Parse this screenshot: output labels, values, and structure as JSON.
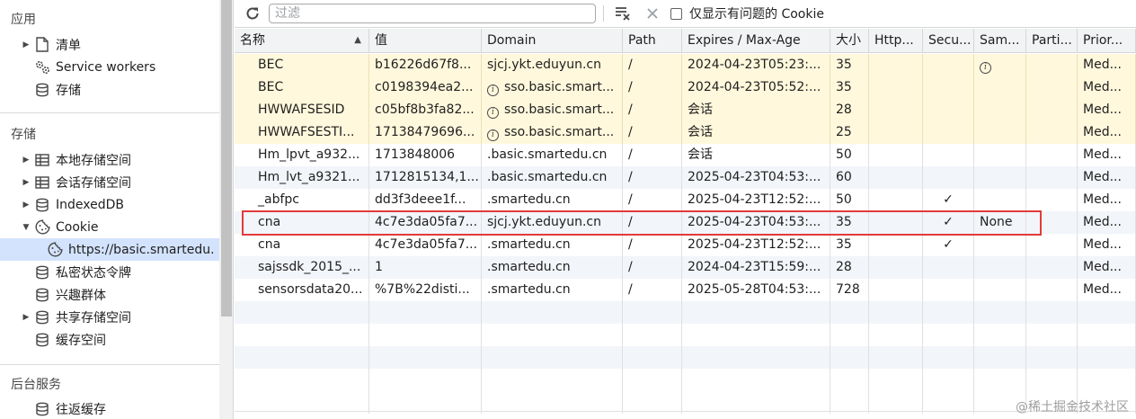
{
  "sidebar": {
    "sections": [
      {
        "title": "应用"
      },
      {
        "title": "存储"
      },
      {
        "title": "后台服务"
      }
    ],
    "app_items": [
      {
        "label": "清单",
        "icon": "document-icon"
      },
      {
        "label": "Service workers",
        "icon": "gears-icon"
      },
      {
        "label": "存储",
        "icon": "database-icon"
      }
    ],
    "storage_items": [
      {
        "label": "本地存储空间",
        "icon": "grid-icon"
      },
      {
        "label": "会话存储空间",
        "icon": "grid-icon"
      },
      {
        "label": "IndexedDB",
        "icon": "database-icon"
      },
      {
        "label": "Cookie",
        "icon": "cookie-icon"
      },
      {
        "label": "https://basic.smartedu.",
        "icon": "cookie-icon"
      },
      {
        "label": "私密状态令牌",
        "icon": "database-icon"
      },
      {
        "label": "兴趣群体",
        "icon": "database-icon"
      },
      {
        "label": "共享存储空间",
        "icon": "database-icon"
      },
      {
        "label": "缓存空间",
        "icon": "database-icon"
      }
    ],
    "bg_items": [
      {
        "label": "往返缓存",
        "icon": "database-icon"
      }
    ]
  },
  "toolbar": {
    "filter_placeholder": "过滤",
    "issues_only_label": "仅显示有问题的 Cookie"
  },
  "table": {
    "headers": [
      "名称",
      "值",
      "Domain",
      "Path",
      "Expires / Max-Age",
      "大小",
      "Http...",
      "Secu...",
      "Sam...",
      "Parti...",
      "Prior..."
    ],
    "rows": [
      {
        "name": "BEC",
        "value": "b16226d67f8...",
        "domain": "sjcj.ykt.eduyun.cn",
        "domain_info": false,
        "path": "/",
        "expires": "2024-04-23T05:23:...",
        "size": "35",
        "http": "",
        "secure": "",
        "samesite": "",
        "samesite_info": true,
        "partition": "",
        "priority": "Med..."
      },
      {
        "name": "BEC",
        "value": "c0198394ea2...",
        "domain": "sso.basic.smart...",
        "domain_info": true,
        "path": "/",
        "expires": "2024-04-23T05:52:...",
        "size": "35",
        "http": "",
        "secure": "",
        "samesite": "",
        "samesite_info": false,
        "partition": "",
        "priority": "Med..."
      },
      {
        "name": "HWWAFSESID",
        "value": "c05bf8b3fa82...",
        "domain": "sso.basic.smart...",
        "domain_info": true,
        "path": "/",
        "expires": "会话",
        "size": "28",
        "http": "",
        "secure": "",
        "samesite": "",
        "samesite_info": false,
        "partition": "",
        "priority": "Med..."
      },
      {
        "name": "HWWAFSESTI...",
        "value": "17138479696...",
        "domain": "sso.basic.smart...",
        "domain_info": true,
        "path": "/",
        "expires": "会话",
        "size": "25",
        "http": "",
        "secure": "",
        "samesite": "",
        "samesite_info": false,
        "partition": "",
        "priority": "Med..."
      },
      {
        "name": "Hm_lpvt_a932...",
        "value": "1713848006",
        "domain": ".basic.smartedu.cn",
        "domain_info": false,
        "path": "/",
        "expires": "会话",
        "size": "50",
        "http": "",
        "secure": "",
        "samesite": "",
        "samesite_info": false,
        "partition": "",
        "priority": "Med..."
      },
      {
        "name": "Hm_lvt_a9321...",
        "value": "1712815134,1...",
        "domain": ".basic.smartedu.cn",
        "domain_info": false,
        "path": "/",
        "expires": "2025-04-23T04:53:...",
        "size": "60",
        "http": "",
        "secure": "",
        "samesite": "",
        "samesite_info": false,
        "partition": "",
        "priority": "Med..."
      },
      {
        "name": "_abfpc",
        "value": "dd3f3deee1f...",
        "domain": ".smartedu.cn",
        "domain_info": false,
        "path": "/",
        "expires": "2025-04-23T12:52:...",
        "size": "50",
        "http": "",
        "secure": "✓",
        "samesite": "",
        "samesite_info": false,
        "partition": "",
        "priority": "Med..."
      },
      {
        "name": "cna",
        "value": "4c7e3da05fa7...",
        "domain": "sjcj.ykt.eduyun.cn",
        "domain_info": false,
        "path": "/",
        "expires": "2025-04-23T04:53:...",
        "size": "35",
        "http": "",
        "secure": "✓",
        "samesite": "None",
        "samesite_info": false,
        "partition": "",
        "priority": "Med..."
      },
      {
        "name": "cna",
        "value": "4c7e3da05fa7...",
        "domain": ".smartedu.cn",
        "domain_info": false,
        "path": "/",
        "expires": "2025-04-23T12:52:...",
        "size": "35",
        "http": "",
        "secure": "✓",
        "samesite": "",
        "samesite_info": false,
        "partition": "",
        "priority": "Med..."
      },
      {
        "name": "sajssdk_2015_...",
        "value": "1",
        "domain": ".smartedu.cn",
        "domain_info": false,
        "path": "/",
        "expires": "2024-04-23T15:59:...",
        "size": "28",
        "http": "",
        "secure": "",
        "samesite": "",
        "samesite_info": false,
        "partition": "",
        "priority": "Med..."
      },
      {
        "name": "sensorsdata20...",
        "value": "%7B%22disti...",
        "domain": ".smartedu.cn",
        "domain_info": false,
        "path": "/",
        "expires": "2025-05-28T04:53:...",
        "size": "728",
        "http": "",
        "secure": "",
        "samesite": "",
        "samesite_info": false,
        "partition": "",
        "priority": "Med..."
      }
    ]
  },
  "watermark": "@稀土掘金技术社区",
  "colors": {
    "warning_row": "#fff8dc",
    "alt_row": "#f2f5f9",
    "selected": "#d3e3fd",
    "highlight_box": "#e23b3b"
  }
}
